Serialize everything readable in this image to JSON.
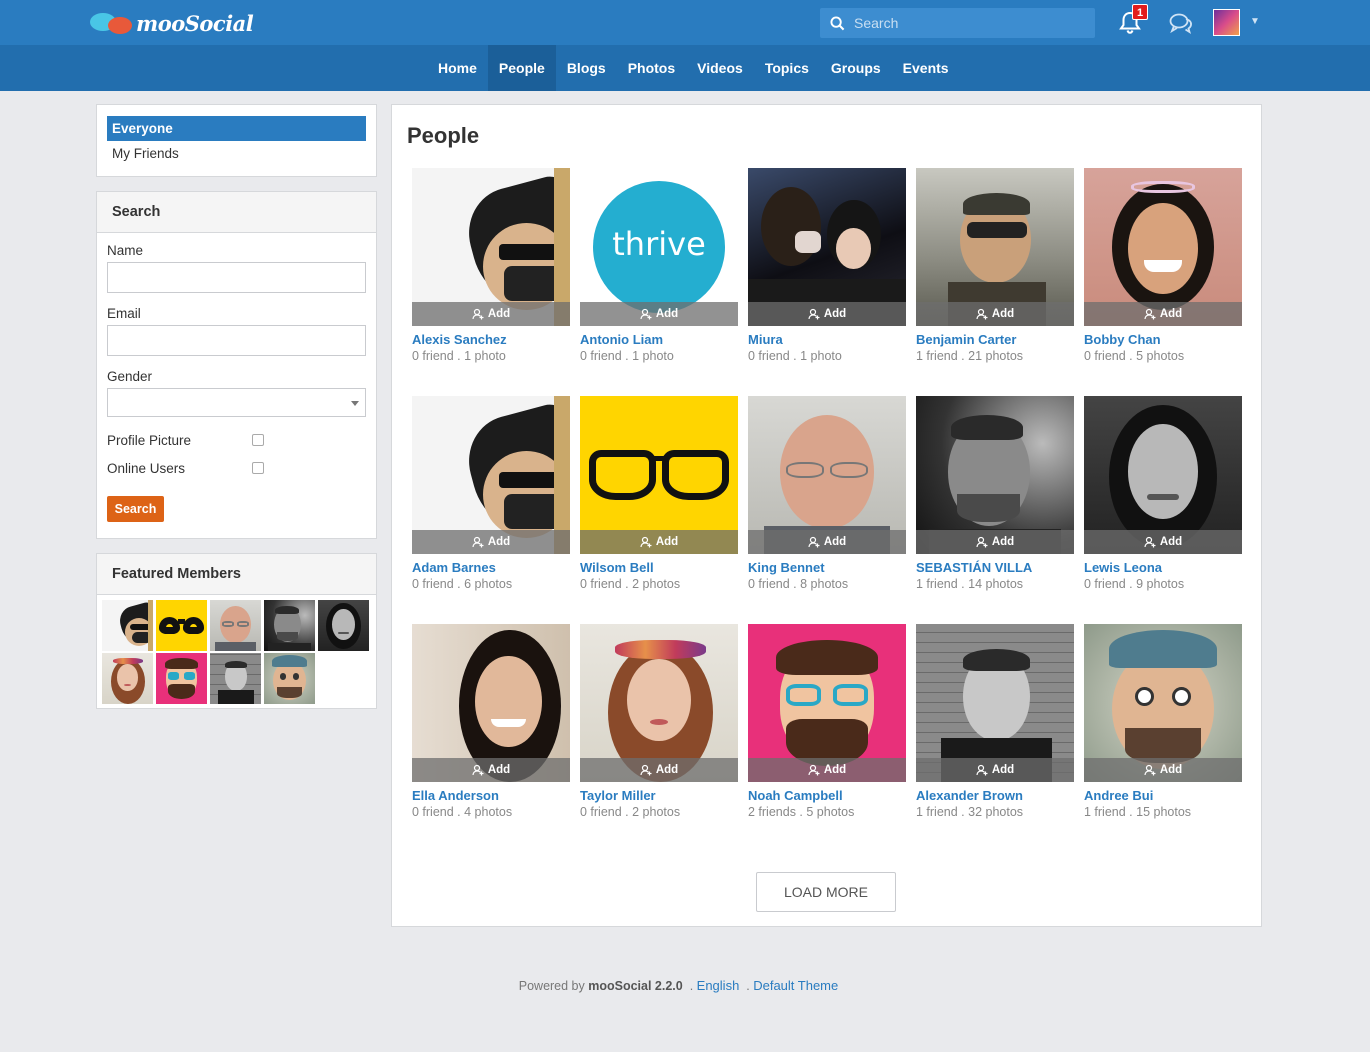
{
  "app": {
    "logo_text": "mooSocial"
  },
  "header": {
    "search_placeholder": "Search",
    "notification_count": "1"
  },
  "nav": {
    "items": [
      "Home",
      "People",
      "Blogs",
      "Photos",
      "Videos",
      "Topics",
      "Groups",
      "Events"
    ],
    "active": "People"
  },
  "filters": {
    "everyone": "Everyone",
    "my_friends": "My Friends"
  },
  "search_form": {
    "title": "Search",
    "name_label": "Name",
    "email_label": "Email",
    "gender_label": "Gender",
    "profile_picture_label": "Profile Picture",
    "online_users_label": "Online Users",
    "submit": "Search"
  },
  "featured": {
    "title": "Featured Members"
  },
  "main": {
    "title": "People",
    "add_label": "Add",
    "load_more": "LOAD MORE"
  },
  "members": [
    {
      "name": "Alexis Sanchez",
      "meta": "0 friend . 1 photo",
      "avatar": "punk-glasses"
    },
    {
      "name": "Antonio Liam",
      "meta": "0 friend . 1 photo",
      "avatar": "thrive-logo",
      "avatar_text": "thrive"
    },
    {
      "name": "Miura",
      "meta": "0 friend . 1 photo",
      "avatar": "party-photo"
    },
    {
      "name": "Benjamin Carter",
      "meta": "1 friend . 21 photos",
      "avatar": "sunglasses-man"
    },
    {
      "name": "Bobby Chan",
      "meta": "0 friend . 5 photos",
      "avatar": "smiling-woman"
    },
    {
      "name": "Adam Barnes",
      "meta": "0 friend . 6 photos",
      "avatar": "punk-glasses"
    },
    {
      "name": "Wilsom Bell",
      "meta": "0 friend . 2 photos",
      "avatar": "glasses-yellow"
    },
    {
      "name": "King Bennet",
      "meta": "0 friend . 8 photos",
      "avatar": "old-man"
    },
    {
      "name": "SEBASTIÁN VILLA",
      "meta": "1 friend . 14 photos",
      "avatar": "bw-man"
    },
    {
      "name": "Lewis Leona",
      "meta": "0 friend . 9 photos",
      "avatar": "bw-woman"
    },
    {
      "name": "Ella Anderson",
      "meta": "0 friend . 4 photos",
      "avatar": "asian-woman"
    },
    {
      "name": "Taylor Miller",
      "meta": "0 friend . 2 photos",
      "avatar": "flower-crown-woman"
    },
    {
      "name": "Noah Campbell",
      "meta": "2 friends . 5 photos",
      "avatar": "cartoon-man"
    },
    {
      "name": "Alexander Brown",
      "meta": "1 friend . 32 photos",
      "avatar": "bw-brick-man"
    },
    {
      "name": "Andree Bui",
      "meta": "1 friend . 15 photos",
      "avatar": "beanie-man"
    }
  ],
  "featured_members": [
    "punk-glasses",
    "glasses-yellow",
    "old-man",
    "bw-man",
    "bw-woman",
    "flower-crown-woman",
    "cartoon-man",
    "bw-brick-man",
    "beanie-man"
  ],
  "footer": {
    "powered_by": "Powered by",
    "product": "mooSocial 2.2.0",
    "sep": ".",
    "language": "English",
    "theme": "Default Theme"
  },
  "colors": {
    "topbar": "#2a7cc0",
    "navbar": "#226eae",
    "accent": "#2a7cc0",
    "button": "#dd6316",
    "badge": "#e21c1c"
  }
}
